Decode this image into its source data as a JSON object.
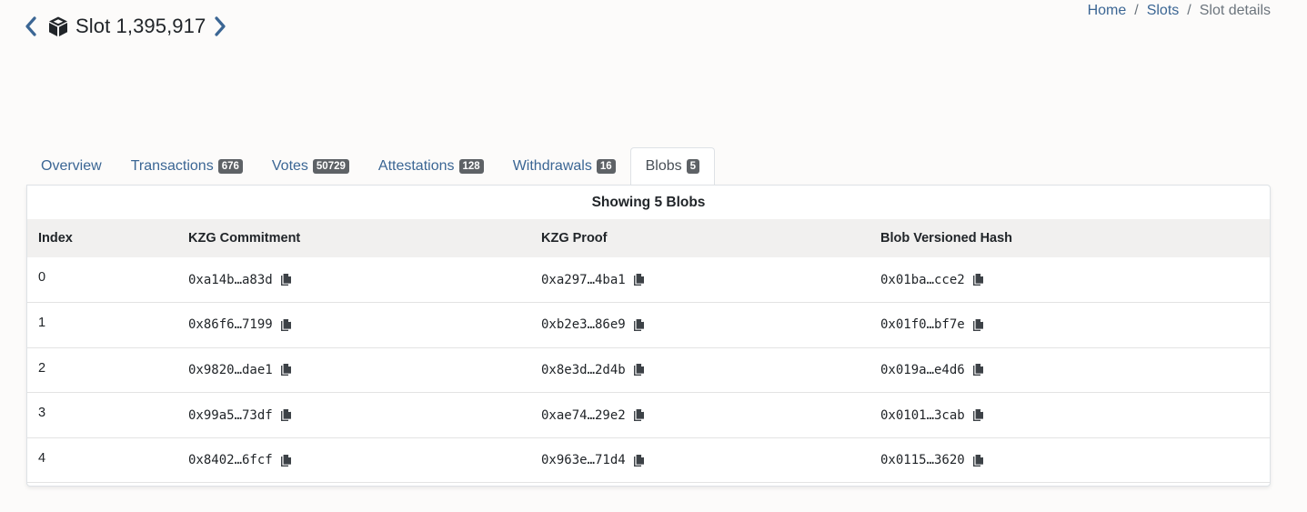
{
  "header": {
    "title": "Slot 1,395,917",
    "prev_icon": "chevron-left-icon",
    "next_icon": "chevron-right-icon",
    "cube_icon": "cube-icon"
  },
  "breadcrumb": {
    "items": [
      "Home",
      "Slots"
    ],
    "current": "Slot details",
    "separator": "/"
  },
  "tabs": [
    {
      "label": "Overview",
      "badge": null
    },
    {
      "label": "Transactions",
      "badge": "676"
    },
    {
      "label": "Votes",
      "badge": "50729"
    },
    {
      "label": "Attestations",
      "badge": "128"
    },
    {
      "label": "Withdrawals",
      "badge": "16"
    },
    {
      "label": "Blobs",
      "badge": "5",
      "active": true
    }
  ],
  "blobs": {
    "heading": "Showing 5 Blobs",
    "columns": [
      "Index",
      "KZG Commitment",
      "KZG Proof",
      "Blob Versioned Hash"
    ],
    "rows": [
      {
        "index": "0",
        "commitment": "0xa14b…a83d",
        "proof": "0xa297…4ba1",
        "hash": "0x01ba…cce2"
      },
      {
        "index": "1",
        "commitment": "0x86f6…7199",
        "proof": "0xb2e3…86e9",
        "hash": "0x01f0…bf7e"
      },
      {
        "index": "2",
        "commitment": "0x9820…dae1",
        "proof": "0x8e3d…2d4b",
        "hash": "0x019a…e4d6"
      },
      {
        "index": "3",
        "commitment": "0x99a5…73df",
        "proof": "0xae74…29e2",
        "hash": "0x0101…3cab"
      },
      {
        "index": "4",
        "commitment": "0x8402…6fcf",
        "proof": "0x963e…71d4",
        "hash": "0x0115…3620"
      }
    ]
  },
  "colors": {
    "link": "#3b6694",
    "badge": "#5e6266",
    "header_row": "#f1f0ef",
    "background": "#fcfbfa"
  }
}
